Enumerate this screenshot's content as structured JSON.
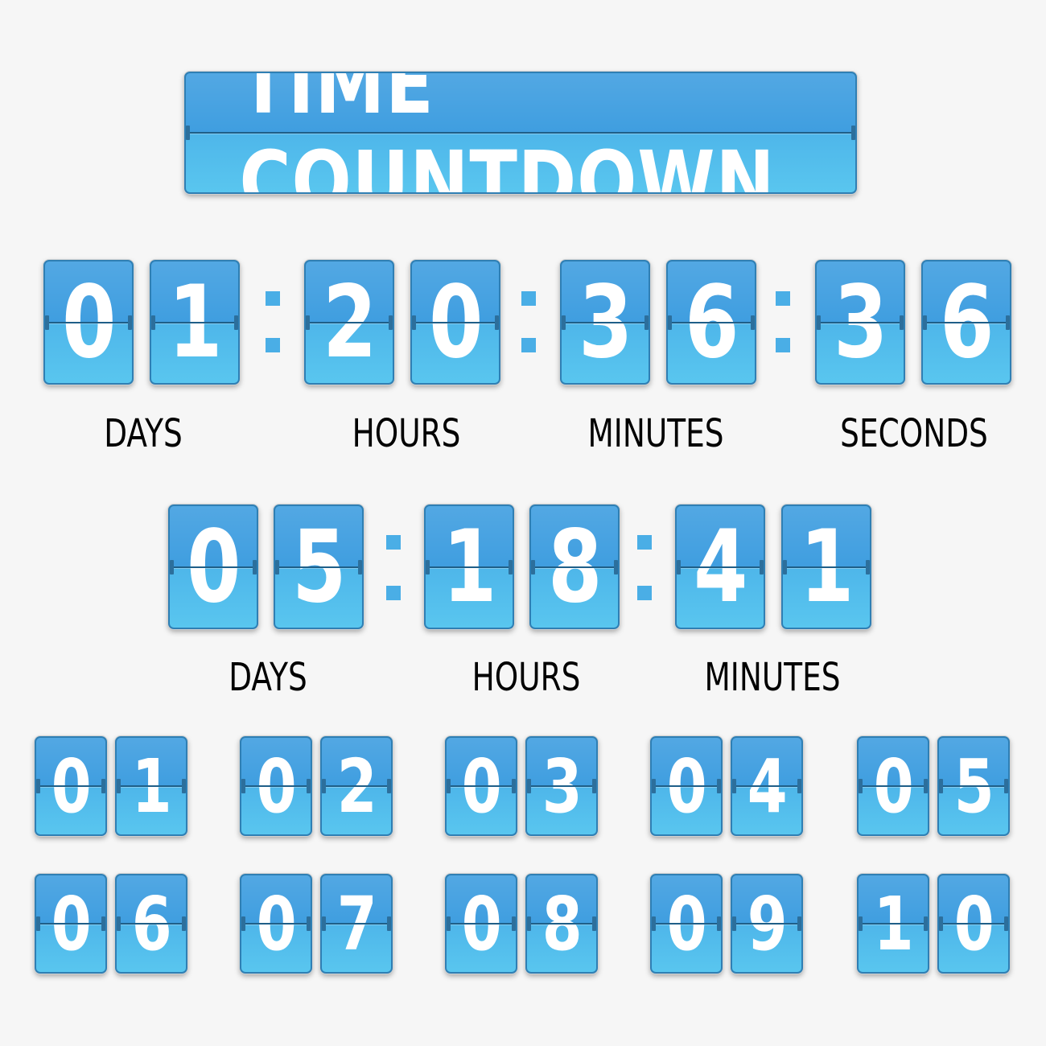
{
  "title": "TIME COUNTDOWN",
  "colors": {
    "background": "#f6f6f6",
    "card_top": "#3f9ee0",
    "card_bottom": "#59c6ef",
    "digit": "#ffffff",
    "label": "#000000"
  },
  "countdown_full": {
    "digits": [
      "0",
      "1",
      "2",
      "0",
      "3",
      "6",
      "3",
      "6"
    ],
    "labels": [
      "DAYS",
      "HOURS",
      "MINUTES",
      "SECONDS"
    ]
  },
  "countdown_short": {
    "digits": [
      "0",
      "5",
      "1",
      "8",
      "4",
      "1"
    ],
    "labels": [
      "DAYS",
      "HOURS",
      "MINUTES"
    ]
  },
  "numbers": [
    "01",
    "02",
    "03",
    "04",
    "05",
    "06",
    "07",
    "08",
    "09",
    "10"
  ]
}
